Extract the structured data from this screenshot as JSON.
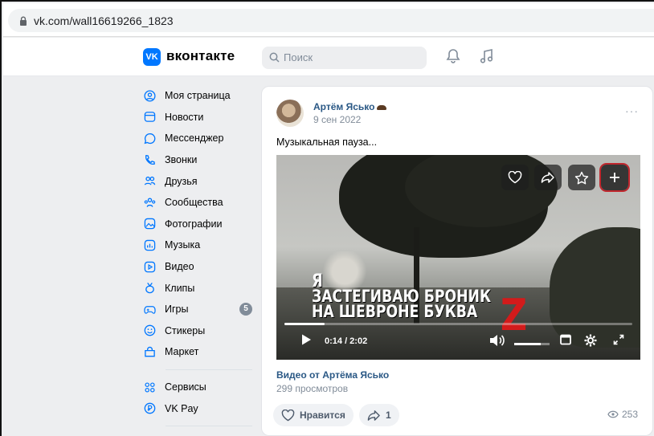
{
  "browser": {
    "url": "vk.com/wall16619266_1823"
  },
  "header": {
    "logo_text": "VK",
    "brand": "вконтакте",
    "search_placeholder": "Поиск"
  },
  "sidebar": {
    "items": [
      {
        "label": "Моя страница",
        "icon": "user-circle-icon"
      },
      {
        "label": "Новости",
        "icon": "news-icon"
      },
      {
        "label": "Мессенджер",
        "icon": "message-icon"
      },
      {
        "label": "Звонки",
        "icon": "phone-icon"
      },
      {
        "label": "Друзья",
        "icon": "friends-icon"
      },
      {
        "label": "Сообщества",
        "icon": "communities-icon"
      },
      {
        "label": "Фотографии",
        "icon": "photo-icon"
      },
      {
        "label": "Музыка",
        "icon": "music-icon"
      },
      {
        "label": "Видео",
        "icon": "video-icon"
      },
      {
        "label": "Клипы",
        "icon": "clips-icon"
      },
      {
        "label": "Игры",
        "icon": "gamepad-icon",
        "badge": "5"
      },
      {
        "label": "Стикеры",
        "icon": "sticker-icon"
      },
      {
        "label": "Маркет",
        "icon": "market-icon"
      }
    ],
    "extra": [
      {
        "label": "Сервисы",
        "icon": "services-icon"
      },
      {
        "label": "VK Pay",
        "icon": "vkpay-icon"
      }
    ]
  },
  "post": {
    "author": "Артём Ясько",
    "date": "9 сен 2022",
    "more": "···",
    "text": "Музыкальная пауза...",
    "video": {
      "caption_line1": "Я",
      "caption_line2": "ЗАСТЕГИВАЮ БРОНИК",
      "caption_line3": "НА ШЕВРОНЕ БУКВА",
      "letter": "Z",
      "time": "0:14 / 2:02",
      "progress": 0.115,
      "volume": 0.75
    },
    "video_title": "Видео от Артёма Ясько",
    "video_views": "299 просмотров",
    "like_label": "Нравится",
    "share_count": "1",
    "views": "253"
  },
  "colors": {
    "accent": "#0077ff",
    "link": "#2a5885",
    "muted": "#818c99"
  }
}
